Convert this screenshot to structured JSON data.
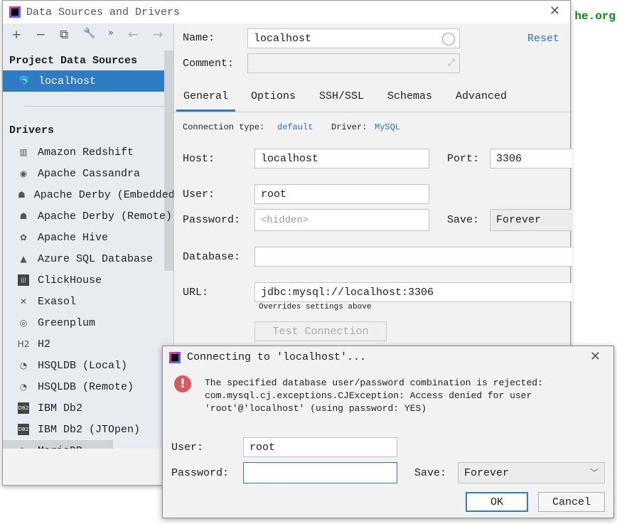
{
  "background": {
    "text": "he.org"
  },
  "window": {
    "title": "Data Sources and Drivers",
    "close": "✕"
  },
  "toolbar": {
    "add": "+",
    "remove": "−",
    "copy": "⧉",
    "settings": "🔧",
    "more": "»",
    "back": "←",
    "forward": "→"
  },
  "sidebar": {
    "project_header": "Project Data Sources",
    "selected": "localhost",
    "drivers_header": "Drivers",
    "drivers": [
      {
        "label": "Amazon Redshift",
        "icon": "▥"
      },
      {
        "label": "Apache Cassandra",
        "icon": "◉"
      },
      {
        "label": "Apache Derby (Embedded)",
        "icon": "☗"
      },
      {
        "label": "Apache Derby (Remote)",
        "icon": "☗"
      },
      {
        "label": "Apache Hive",
        "icon": "✿"
      },
      {
        "label": "Azure SQL Database",
        "icon": "▲"
      },
      {
        "label": "ClickHouse",
        "icon": "|||"
      },
      {
        "label": "Exasol",
        "icon": "✕"
      },
      {
        "label": "Greenplum",
        "icon": "◎"
      },
      {
        "label": "H2",
        "icon": "H2"
      },
      {
        "label": "HSQLDB (Local)",
        "icon": "◔"
      },
      {
        "label": "HSQLDB (Remote)",
        "icon": "◔"
      },
      {
        "label": "IBM Db2",
        "icon": "DB2"
      },
      {
        "label": "IBM Db2 (JTOpen)",
        "icon": "DB2"
      },
      {
        "label": "MariaDB",
        "icon": "✎"
      }
    ],
    "help": "?"
  },
  "form": {
    "name_label": "Name:",
    "name_value": "localhost",
    "reset": "Reset",
    "comment_label": "Comment:",
    "comment_value": "",
    "tabs": [
      "General",
      "Options",
      "SSH/SSL",
      "Schemas",
      "Advanced"
    ],
    "active_tab": "General",
    "conn_type_label": "Connection type:",
    "conn_type": "default",
    "driver_label": "Driver:",
    "driver": "MySQL",
    "host_label": "Host:",
    "host": "localhost",
    "port_label": "Port:",
    "port": "3306",
    "user_label": "User:",
    "user": "root",
    "password_label": "Password:",
    "password_placeholder": "<hidden>",
    "save_label": "Save:",
    "save": "Forever",
    "database_label": "Database:",
    "database": "",
    "url_label": "URL:",
    "url": "jdbc:mysql://localhost:3306",
    "url_hint": "Overrides settings above",
    "test": "Test Connection"
  },
  "dialog": {
    "title": "Connecting to 'localhost'...",
    "close": "✕",
    "message": "The specified database user/password combination is rejected:\ncom.mysql.cj.exceptions.CJException: Access denied for user\n'root'@'localhost' (using password: YES)",
    "user_label": "User:",
    "user": "root",
    "password_label": "Password:",
    "password": "",
    "save_label": "Save:",
    "save": "Forever",
    "ok": "OK",
    "cancel": "Cancel"
  },
  "colors": {
    "accent": "#2f7bc4",
    "link": "#2a73c6",
    "error": "#db5860"
  }
}
